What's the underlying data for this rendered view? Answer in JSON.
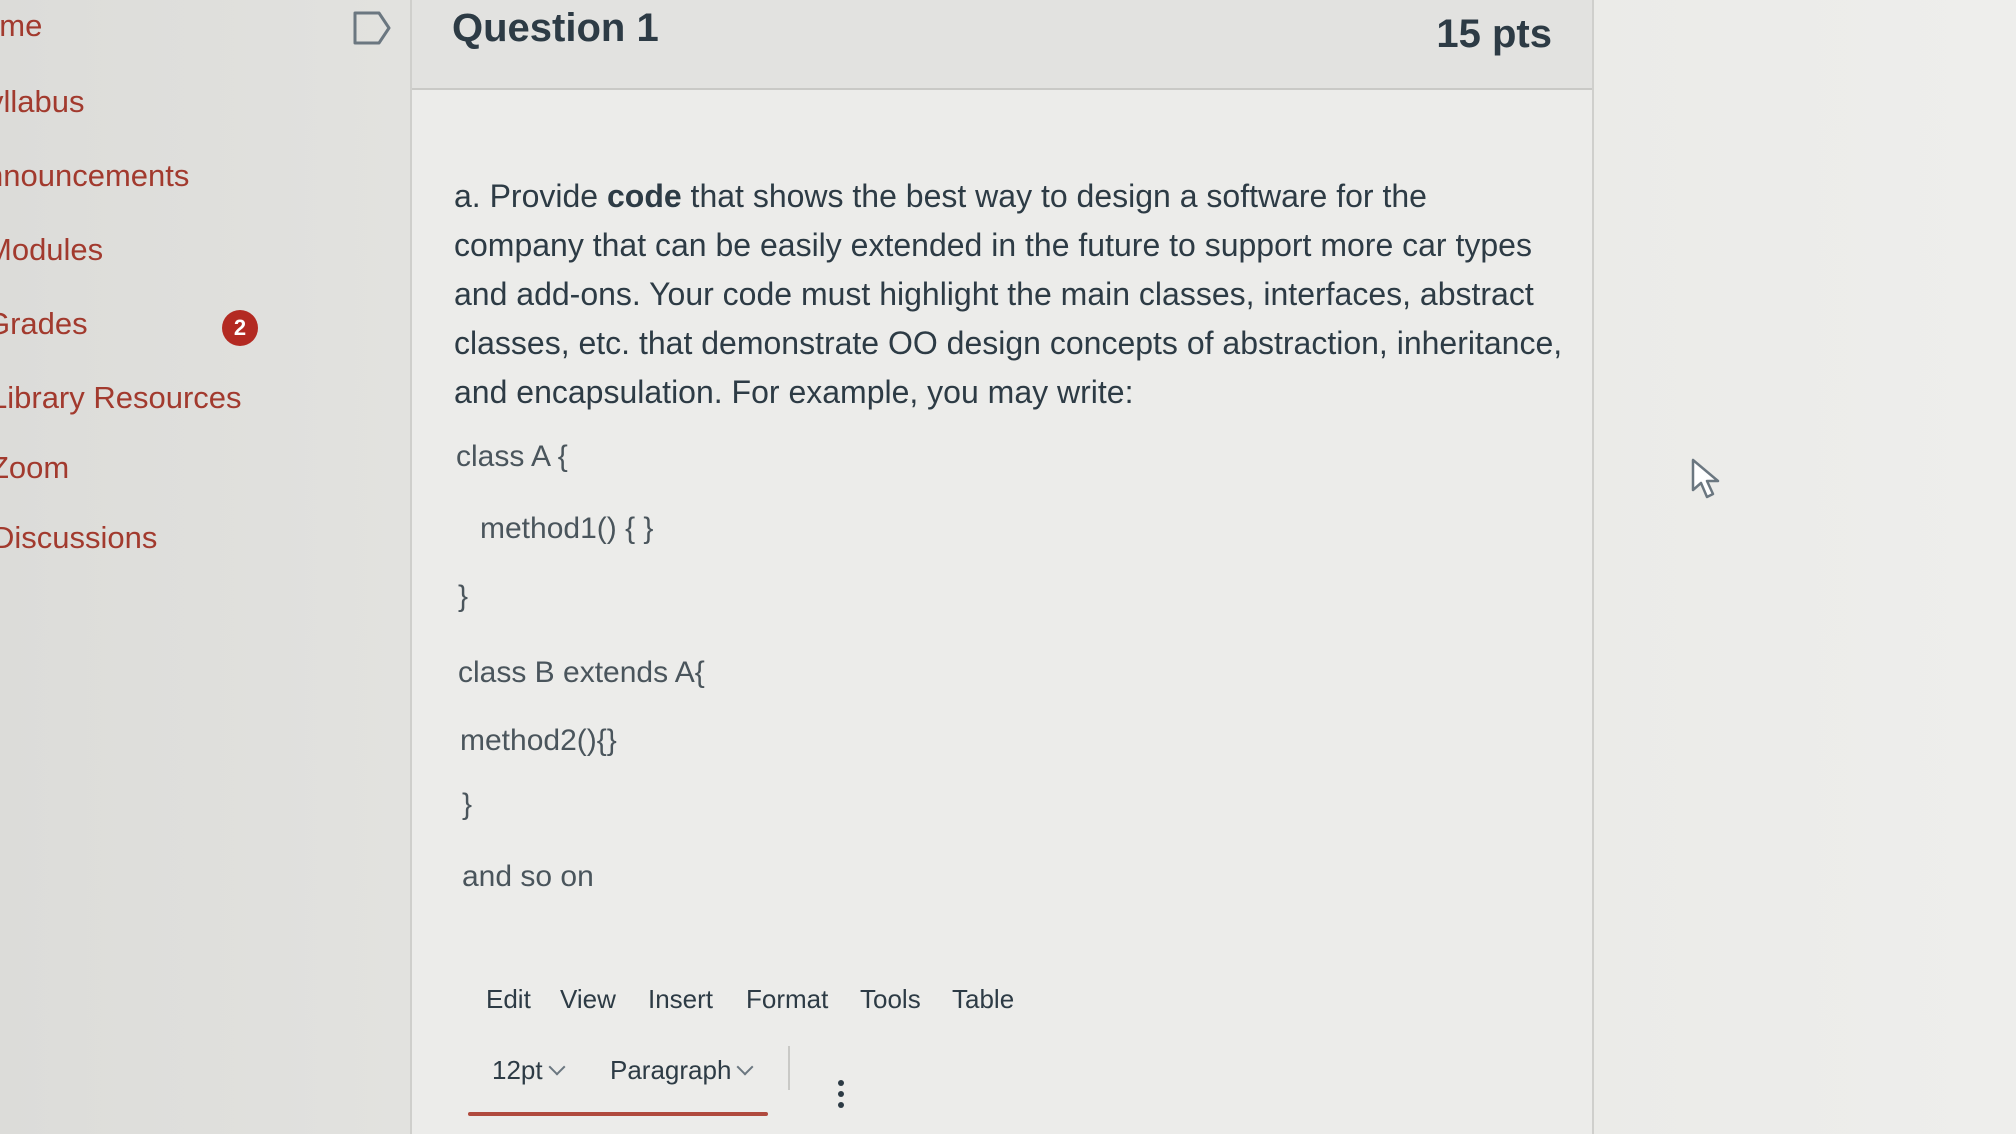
{
  "sidebar": {
    "items": [
      {
        "label": "ome"
      },
      {
        "label": "yllabus"
      },
      {
        "label": "nnouncements"
      },
      {
        "label": "Modules"
      },
      {
        "label": "Grades"
      },
      {
        "label": "Library Resources"
      },
      {
        "label": "Zoom"
      },
      {
        "label": "Discussions"
      }
    ],
    "grades_badge": "2"
  },
  "question": {
    "title": "Question 1",
    "points": "15 pts",
    "prompt_part1": "a. Provide ",
    "prompt_bold": "code",
    "prompt_part2": " that shows the best way to design a software for the company that can be easily extended in the future to support more car types and add-ons. Your code must highlight the main classes, interfaces, abstract classes, etc. that demonstrate OO design concepts of abstraction, inheritance, and encapsulation. For example, you may write:",
    "code_lines": [
      "class A {",
      "method1() { }",
      "}",
      "class B extends A{",
      "method2(){}",
      "}",
      "and so on"
    ]
  },
  "editor": {
    "menu": [
      "Edit",
      "View",
      "Insert",
      "Format",
      "Tools",
      "Table"
    ],
    "font_size": "12pt",
    "block_format": "Paragraph"
  },
  "colors": {
    "link": "#a23a2e",
    "badge": "#b32a22",
    "text": "#2d3b45"
  },
  "icons": {
    "bookmark": "bookmark-outline-icon",
    "more": "vertical-ellipsis-icon",
    "cursor": "mouse-pointer-icon"
  }
}
